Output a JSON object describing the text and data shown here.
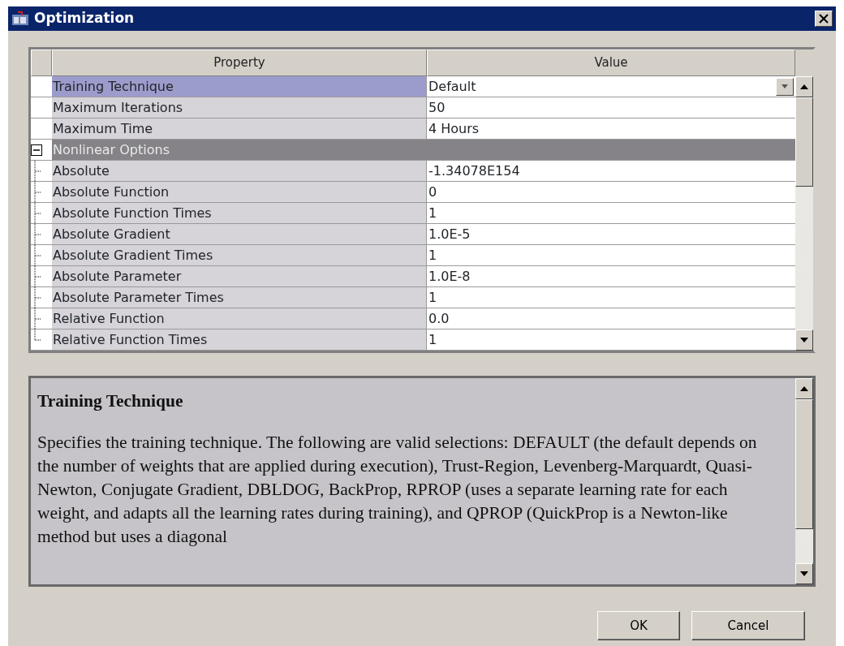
{
  "window": {
    "title": "Optimization"
  },
  "table": {
    "columns": [
      "Property",
      "Value"
    ],
    "rows": [
      {
        "kind": "property",
        "property": "Training Technique",
        "value": "Default",
        "selected": true,
        "dropdown": true
      },
      {
        "kind": "property",
        "property": "Maximum Iterations",
        "value": "50",
        "selected": false,
        "dropdown": false
      },
      {
        "kind": "property",
        "property": "Maximum Time",
        "value": "4 Hours",
        "selected": false,
        "dropdown": false
      },
      {
        "kind": "group",
        "property": "Nonlinear Options",
        "expanded": true,
        "children": [
          {
            "property": "Absolute",
            "value": "-1.34078E154"
          },
          {
            "property": "Absolute Function",
            "value": "0"
          },
          {
            "property": "Absolute Function Times",
            "value": "1"
          },
          {
            "property": "Absolute Gradient",
            "value": "1.0E-5"
          },
          {
            "property": "Absolute Gradient Times",
            "value": "1"
          },
          {
            "property": "Absolute Parameter",
            "value": "1.0E-8"
          },
          {
            "property": "Absolute Parameter Times",
            "value": "1"
          },
          {
            "property": "Relative Function",
            "value": "0.0"
          },
          {
            "property": "Relative Function Times",
            "value": "1"
          }
        ]
      }
    ]
  },
  "description": {
    "heading": "Training Technique",
    "text": "Specifies the training technique. The following are valid selections: DEFAULT (the default depends on the number of weights that are applied during execution), Trust-Region, Levenberg-Marquardt, Quasi-Newton, Conjugate Gradient, DBLDOG, BackProp, RPROP (uses a separate learning rate for each weight, and adapts all the learning rates during training), and QPROP (QuickProp is a Newton-like method but uses a diagonal"
  },
  "buttons": [
    "OK",
    "Cancel"
  ]
}
